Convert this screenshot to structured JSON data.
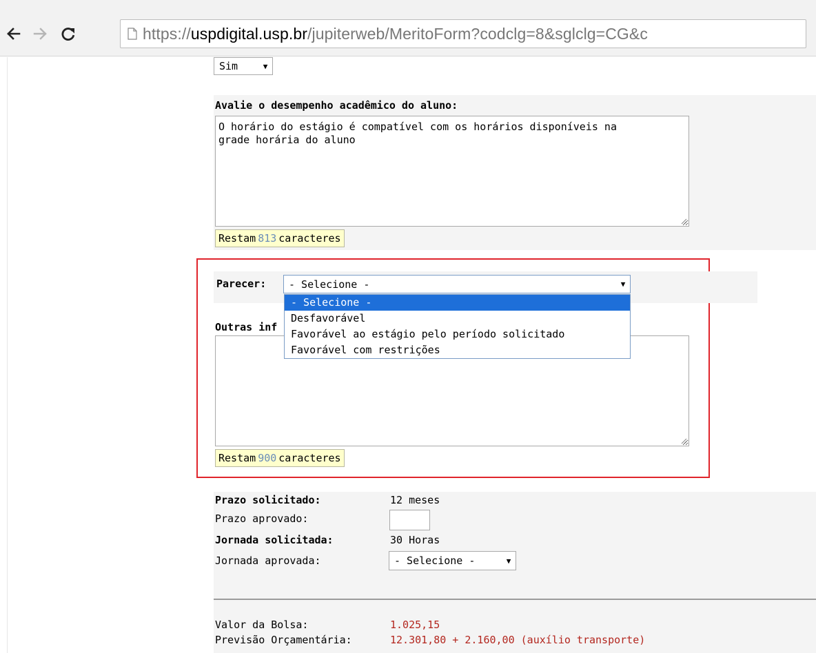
{
  "browser": {
    "url_prefix": "https://",
    "url_host": "uspdigital.usp.br",
    "url_path": "/jupiterweb/MeritoForm?codclg=8&sglclg=CG&c"
  },
  "form": {
    "top_select": {
      "value": "Sim"
    },
    "desempenho": {
      "label": "Avalie o desempenho acadêmico do aluno:",
      "text_line1": "O horário do estágio é compatível com os horários disponíveis na",
      "text_line2": "grade horária do aluno",
      "counter_prefix": "Restam",
      "counter_value": "813",
      "counter_suffix": "caracteres"
    },
    "parecer": {
      "label": "Parecer:",
      "value": "- Selecione -",
      "options": [
        "- Selecione -",
        "Desfavorável",
        "Favorável ao estágio pelo período solicitado",
        "Favorável com restrições"
      ]
    },
    "outras": {
      "label": "Outras inf",
      "counter_prefix": "Restam",
      "counter_value": "900",
      "counter_suffix": "caracteres"
    },
    "prazo": {
      "solicitado_label": "Prazo solicitado:",
      "solicitado_value": "12 meses",
      "aprovado_label": "Prazo aprovado:",
      "jornada_solicitada_label": "Jornada solicitada:",
      "jornada_solicitada_value": "30 Horas",
      "jornada_aprovada_label": "Jornada aprovada:",
      "jornada_aprovada_value": "- Selecione -"
    },
    "bolsa": {
      "valor_label": "Valor da Bolsa:",
      "valor_value": "1.025,15",
      "previsao_label": "Previsão Orçamentária:",
      "previsao_value": "12.301,80 + 2.160,00 (auxílio transporte)"
    }
  },
  "colors": {
    "highlight": "#e0242b",
    "selected_option": "#1e6fd9",
    "counter_bg": "#ffffcc",
    "value_red": "#b3261e"
  },
  "icons": [
    "back-arrow-icon",
    "forward-arrow-icon",
    "reload-icon",
    "page-icon",
    "chevron-down-icon",
    "resize-grip-icon"
  ]
}
